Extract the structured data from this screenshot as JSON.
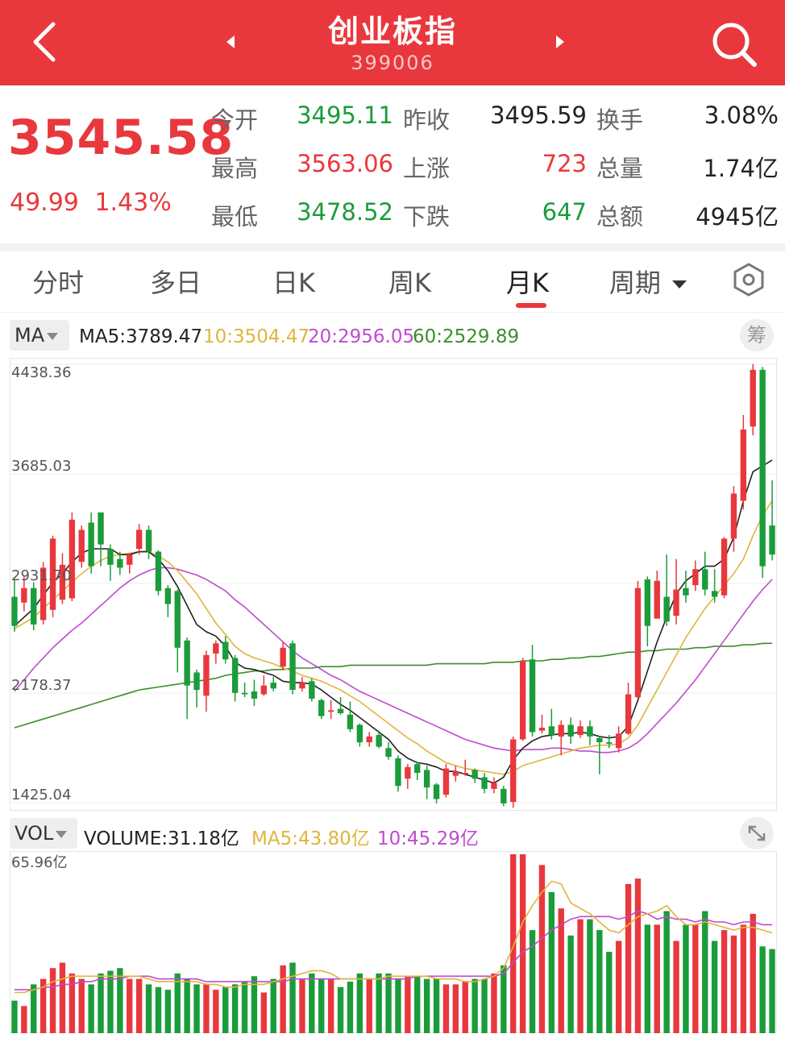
{
  "header": {
    "title": "创业板指",
    "code": "399006"
  },
  "quote": {
    "price": "3545.58",
    "change": "49.99",
    "change_pct": "1.43%",
    "rows": [
      {
        "l1": "今开",
        "v1": "3495.11",
        "l2": "昨收",
        "v2": "3495.59",
        "l3": "换手",
        "v3": "3.08%"
      },
      {
        "l1": "最高",
        "v1": "3563.06",
        "l2": "上涨",
        "v2": "723",
        "l3": "总量",
        "v3": "1.74亿"
      },
      {
        "l1": "最低",
        "v1": "3478.52",
        "l2": "下跌",
        "v2": "647",
        "l3": "总额",
        "v3": "4945亿"
      }
    ]
  },
  "tabs": [
    "分时",
    "多日",
    "日K",
    "周K",
    "月K",
    "周期"
  ],
  "active_tab": "月K",
  "ma_bar": {
    "selector": "MA",
    "ma5": "MA5:3789.47",
    "ma10": "10:3504.47",
    "ma20": "20:2956.05",
    "ma60": "60:2529.89",
    "chip_label": "筹"
  },
  "vol_bar": {
    "selector": "VOL",
    "volume": "VOLUME:31.18亿",
    "ma5": "MA5:43.80亿",
    "ma10": "10:45.29亿"
  },
  "colors": {
    "up": "#e8383d",
    "down": "#1a9c3a",
    "ma5": "#222222",
    "ma10": "#e0b43c",
    "ma20": "#c04ad0",
    "ma60": "#3a8f2c"
  },
  "chart_data": {
    "type": "candlestick",
    "y_axis_labels": [
      "4438.36",
      "3685.03",
      "2931.70",
      "2178.37",
      "1425.04"
    ],
    "ylim": [
      1425.04,
      4438.36
    ],
    "vol_axis_label": "65.96亿",
    "vol_ylim": [
      0,
      65.96
    ],
    "candles": [
      [
        2840,
        2640,
        2960,
        2600
      ],
      [
        2800,
        2900,
        2980,
        2740
      ],
      [
        2900,
        2650,
        2940,
        2610
      ],
      [
        2680,
        3040,
        3080,
        2650
      ],
      [
        2750,
        3240,
        3260,
        2700
      ],
      [
        2820,
        3060,
        3140,
        2790
      ],
      [
        2830,
        3370,
        3420,
        2810
      ],
      [
        3080,
        3300,
        3330,
        3040
      ],
      [
        3350,
        3050,
        3420,
        3000
      ],
      [
        3420,
        3200,
        3420,
        3050
      ],
      [
        3170,
        3060,
        3200,
        2950
      ],
      [
        3100,
        3040,
        3150,
        2990
      ],
      [
        3060,
        3130,
        3140,
        3000
      ],
      [
        3170,
        3300,
        3340,
        3130
      ],
      [
        3300,
        3150,
        3330,
        3100
      ],
      [
        3150,
        2880,
        3160,
        2850
      ],
      [
        2900,
        2790,
        2920,
        2700
      ],
      [
        2880,
        2490,
        2890,
        2320
      ],
      [
        2540,
        2230,
        2560,
        2000
      ],
      [
        2320,
        2200,
        2340,
        2080
      ],
      [
        2160,
        2440,
        2470,
        2050
      ],
      [
        2450,
        2520,
        2540,
        2380
      ],
      [
        2530,
        2410,
        2570,
        2380
      ],
      [
        2420,
        2180,
        2440,
        2120
      ],
      [
        2180,
        2170,
        2250,
        2150
      ],
      [
        2190,
        2140,
        2270,
        2090
      ],
      [
        2170,
        2230,
        2300,
        2160
      ],
      [
        2250,
        2210,
        2290,
        2190
      ],
      [
        2360,
        2490,
        2530,
        2340
      ],
      [
        2520,
        2200,
        2540,
        2170
      ],
      [
        2210,
        2250,
        2290,
        2190
      ],
      [
        2260,
        2140,
        2280,
        2120
      ],
      [
        2130,
        2020,
        2140,
        2000
      ],
      [
        2050,
        2060,
        2130,
        2000
      ],
      [
        2070,
        2040,
        2150,
        2030
      ],
      [
        2030,
        1930,
        2120,
        1910
      ],
      [
        1960,
        1840,
        1970,
        1810
      ],
      [
        1840,
        1880,
        1910,
        1810
      ],
      [
        1890,
        1810,
        1920,
        1800
      ],
      [
        1800,
        1740,
        1840,
        1720
      ],
      [
        1730,
        1540,
        1750,
        1500
      ],
      [
        1590,
        1670,
        1690,
        1520
      ],
      [
        1690,
        1630,
        1700,
        1580
      ],
      [
        1650,
        1530,
        1680,
        1450
      ],
      [
        1550,
        1450,
        1560,
        1420
      ],
      [
        1480,
        1660,
        1690,
        1460
      ],
      [
        1610,
        1640,
        1680,
        1570
      ],
      [
        1620,
        1630,
        1720,
        1610
      ],
      [
        1650,
        1590,
        1660,
        1560
      ],
      [
        1600,
        1520,
        1630,
        1490
      ],
      [
        1520,
        1560,
        1600,
        1490
      ],
      [
        1520,
        1420,
        1540,
        1400
      ],
      [
        1430,
        1860,
        1880,
        1390
      ],
      [
        1860,
        2400,
        2420,
        1850
      ],
      [
        2410,
        1910,
        2510,
        1880
      ],
      [
        1920,
        1940,
        2030,
        1900
      ],
      [
        1950,
        1890,
        2070,
        1860
      ],
      [
        1880,
        1960,
        1990,
        1750
      ],
      [
        1960,
        1880,
        2010,
        1830
      ],
      [
        1890,
        1950,
        1990,
        1870
      ],
      [
        1950,
        1880,
        1990,
        1820
      ],
      [
        1870,
        1840,
        1880,
        1620
      ],
      [
        1840,
        1830,
        1890,
        1800
      ],
      [
        1800,
        1900,
        1950,
        1770
      ],
      [
        1900,
        2170,
        2250,
        1890
      ],
      [
        2150,
        2900,
        2950,
        2140
      ],
      [
        2960,
        2640,
        2980,
        2500
      ],
      [
        2690,
        2950,
        3020,
        2690
      ],
      [
        2840,
        2670,
        3130,
        2640
      ],
      [
        2710,
        2890,
        3100,
        2650
      ],
      [
        2900,
        2850,
        3020,
        2800
      ],
      [
        2920,
        3030,
        3090,
        2880
      ],
      [
        3030,
        2890,
        3150,
        2850
      ],
      [
        2880,
        2840,
        3030,
        2800
      ],
      [
        2850,
        3240,
        3250,
        2830
      ],
      [
        3240,
        3550,
        3600,
        3150
      ],
      [
        3500,
        3990,
        4090,
        3440
      ],
      [
        4010,
        4400,
        4440,
        3950
      ],
      [
        4400,
        3050,
        4420,
        2970
      ],
      [
        3330,
        3130,
        3640,
        3090
      ]
    ],
    "ma5": [
      2640,
      2700,
      2760,
      2850,
      2940,
      3000,
      3080,
      3140,
      3170,
      3170,
      3170,
      3130,
      3130,
      3150,
      3150,
      3100,
      3020,
      2910,
      2780,
      2650,
      2600,
      2570,
      2500,
      2390,
      2350,
      2340,
      2320,
      2300,
      2260,
      2250,
      2250,
      2240,
      2200,
      2150,
      2100,
      2060,
      2010,
      1960,
      1910,
      1860,
      1780,
      1730,
      1700,
      1690,
      1670,
      1640,
      1640,
      1620,
      1600,
      1580,
      1560,
      1600,
      1720,
      1800,
      1850,
      1880,
      1890,
      1900,
      1900,
      1910,
      1900,
      1880,
      1870,
      1880,
      1950,
      2130,
      2330,
      2530,
      2700,
      2860,
      2950,
      3000,
      3050,
      3050,
      3100,
      3250,
      3500,
      3700,
      3740,
      3780
    ],
    "ma10": [
      2620,
      2660,
      2700,
      2760,
      2820,
      2880,
      2940,
      3000,
      3050,
      3090,
      3120,
      3130,
      3140,
      3150,
      3150,
      3120,
      3080,
      3020,
      2940,
      2860,
      2760,
      2660,
      2580,
      2500,
      2450,
      2420,
      2400,
      2380,
      2350,
      2330,
      2300,
      2280,
      2260,
      2230,
      2200,
      2160,
      2120,
      2070,
      2020,
      1970,
      1920,
      1870,
      1830,
      1780,
      1740,
      1700,
      1680,
      1660,
      1650,
      1640,
      1630,
      1620,
      1640,
      1680,
      1700,
      1720,
      1740,
      1760,
      1780,
      1800,
      1810,
      1820,
      1820,
      1830,
      1870,
      1960,
      2080,
      2200,
      2320,
      2440,
      2560,
      2660,
      2760,
      2840,
      2920,
      3000,
      3100,
      3260,
      3400,
      3500
    ],
    "ma20": [
      2190,
      2270,
      2350,
      2420,
      2490,
      2550,
      2610,
      2660,
      2720,
      2780,
      2840,
      2900,
      2950,
      2990,
      3020,
      3040,
      3040,
      3030,
      3010,
      2990,
      2960,
      2920,
      2880,
      2820,
      2770,
      2710,
      2650,
      2590,
      2530,
      2470,
      2420,
      2380,
      2340,
      2300,
      2270,
      2230,
      2190,
      2160,
      2130,
      2100,
      2070,
      2040,
      2010,
      1980,
      1950,
      1920,
      1890,
      1860,
      1840,
      1820,
      1800,
      1790,
      1780,
      1790,
      1790,
      1790,
      1800,
      1800,
      1790,
      1780,
      1780,
      1770,
      1770,
      1780,
      1800,
      1840,
      1900,
      1970,
      2040,
      2110,
      2190,
      2270,
      2360,
      2450,
      2540,
      2630,
      2720,
      2810,
      2890,
      2960
    ],
    "ma60": [
      1940,
      1960,
      1980,
      2000,
      2020,
      2040,
      2060,
      2080,
      2100,
      2120,
      2140,
      2160,
      2180,
      2200,
      2210,
      2220,
      2230,
      2240,
      2250,
      2260,
      2270,
      2280,
      2300,
      2310,
      2320,
      2330,
      2330,
      2340,
      2340,
      2350,
      2350,
      2350,
      2360,
      2360,
      2360,
      2370,
      2370,
      2370,
      2370,
      2370,
      2370,
      2370,
      2370,
      2370,
      2380,
      2380,
      2380,
      2380,
      2380,
      2380,
      2390,
      2390,
      2390,
      2400,
      2400,
      2400,
      2410,
      2410,
      2420,
      2420,
      2430,
      2430,
      2440,
      2450,
      2460,
      2460,
      2470,
      2470,
      2480,
      2480,
      2480,
      2490,
      2490,
      2500,
      2500,
      2500,
      2510,
      2510,
      2520,
      2520
    ],
    "volume": [
      12,
      10,
      18,
      20,
      24,
      26,
      22,
      20,
      18,
      22,
      23,
      24,
      20,
      20,
      18,
      17,
      16,
      22,
      20,
      18,
      18,
      16,
      17,
      18,
      19,
      21,
      15,
      20,
      25,
      26,
      20,
      22,
      20,
      20,
      17,
      19,
      22,
      20,
      22,
      22,
      20,
      21,
      21,
      20,
      20,
      18,
      18,
      19,
      20,
      20,
      22,
      25,
      70,
      72,
      38,
      62,
      52,
      46,
      36,
      42,
      42,
      38,
      30,
      34,
      55,
      57,
      40,
      40,
      45,
      34,
      40,
      40,
      45,
      34,
      38,
      36,
      40,
      44,
      32,
      31
    ],
    "vol_ma5": [
      15,
      15,
      16,
      17,
      19,
      20,
      21,
      21,
      21,
      21,
      21,
      21,
      21,
      21,
      20,
      19,
      19,
      19,
      19,
      19,
      18,
      18,
      17,
      17,
      18,
      18,
      18,
      19,
      20,
      21,
      22,
      23,
      23,
      22,
      20,
      20,
      20,
      20,
      20,
      21,
      21,
      21,
      21,
      21,
      20,
      20,
      20,
      19,
      19,
      20,
      21,
      24,
      32,
      41,
      47,
      52,
      56,
      55,
      48,
      46,
      44,
      41,
      38,
      37,
      40,
      43,
      44,
      45,
      47,
      43,
      40,
      40,
      41,
      40,
      39,
      38,
      39,
      39,
      38,
      37
    ],
    "vol_ma10": [
      16,
      16,
      16,
      17,
      17,
      18,
      18,
      19,
      19,
      20,
      20,
      20,
      21,
      21,
      21,
      20,
      20,
      20,
      20,
      20,
      19,
      19,
      19,
      19,
      19,
      19,
      19,
      19,
      19,
      20,
      20,
      20,
      20,
      20,
      20,
      20,
      20,
      20,
      20,
      20,
      20,
      20,
      21,
      21,
      21,
      21,
      21,
      21,
      21,
      21,
      21,
      22,
      26,
      30,
      32,
      35,
      38,
      40,
      42,
      43,
      43,
      43,
      43,
      42,
      43,
      45,
      44,
      42,
      43,
      42,
      42,
      41,
      42,
      41,
      41,
      40,
      41,
      41,
      40,
      40
    ]
  }
}
